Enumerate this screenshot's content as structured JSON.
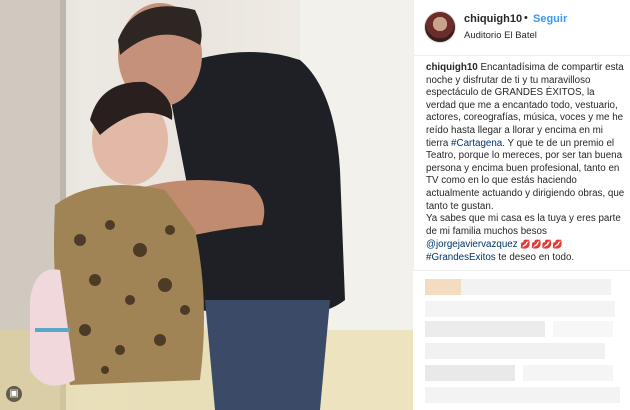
{
  "post": {
    "username": "chiquigh10",
    "separator": "•",
    "follow_label": "Seguir",
    "location": "Auditorio El Batel"
  },
  "caption": {
    "username": "chiquigh10",
    "text_part1": "Encantadísima de compartir esta noche y disfrutar de ti y tu maravilloso espectáculo de GRANDES ÉXITOS, la verdad que me a encantado todo, vestuario, actores, coreografías, música, voces y me he reído hasta llegar a llorar y encima en mi tierra ",
    "hashtag1": "#Cartagena",
    "text_part2": ". Y que te de un premio el Teatro, porque lo mereces, por ser tan buena persona y encima buen profesional, tanto en TV como en lo que estás haciendo actualmente actuando y dirigiendo obras, que tanto te gustan.",
    "text_part3": "Ya sabes que mi casa es la tuya y eres parte de mi familia muchos besos",
    "mention": "@jorgejaviervazquez",
    "emojis": "💋💋💋💋",
    "hashtag2": "#GrandesExitos",
    "text_part4": " te deseo en todo."
  },
  "colors": {
    "link_blue": "#003569",
    "follow_blue": "#3897f0",
    "kiss_red": "#d0021b"
  },
  "icons": {
    "badge": "carousel-icon"
  }
}
